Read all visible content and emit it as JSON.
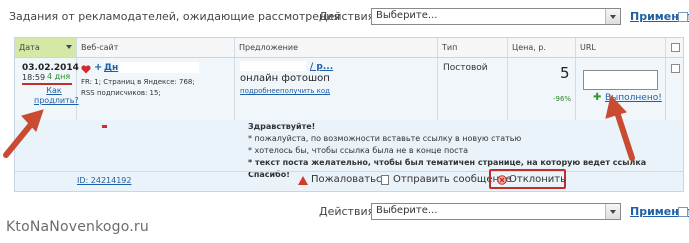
{
  "header": {
    "title": "Задания от рекламодателей, ожидающие рассмотрения",
    "actions_label": "Действия:",
    "select_value": "Выберите...",
    "apply_label": "Применить"
  },
  "table": {
    "columns": [
      "Дата",
      "Веб-сайт",
      "Предложение",
      "Тип",
      "Цена, р.",
      "URL"
    ],
    "row": {
      "date": "03.02.2014",
      "time": "18:59",
      "days_left": "4 дня",
      "extend_link": "Как продлить?",
      "site_name": "Дн",
      "site_fr": "FR: 1; Страниц в Яндексе: 768;",
      "site_rss": "RSS подписчиков: 15;",
      "offer_title": "/ р...",
      "offer_desc": "онлайн фотошоп",
      "link_details": "подробнее",
      "link_get_code": "получить код",
      "type": "Постовой",
      "price": "5",
      "percent": "-96%",
      "done_label": "Выполнено!"
    },
    "message": {
      "greeting": "Здравствуйте!",
      "line1": "* пожалуйста, по возможности вставьте ссылку в новую статью",
      "line2": "* хотелось бы, чтобы ссылка была не в конце поста",
      "line3": "* текст поста желательно, чтобы был тематичен странице, на которую ведет ссылка",
      "thanks": "Спасибо!"
    },
    "footer": {
      "id_label": "ID: 24214192",
      "complain_label": "Пожаловаться",
      "send_message_label": "Отправить сообщение",
      "reject_label": "Отклонить"
    }
  },
  "bottom_bar": {
    "actions_label": "Действия:",
    "select_value": "Выберите...",
    "apply_label": "Применить"
  },
  "watermark": "KtoNaNovenkogo.ru",
  "colors": {
    "accent_link": "#1f5fa6",
    "highlight_red": "#c0302a",
    "date_column_header": "#d6e8a6",
    "row_background": "#eaf2fa"
  }
}
